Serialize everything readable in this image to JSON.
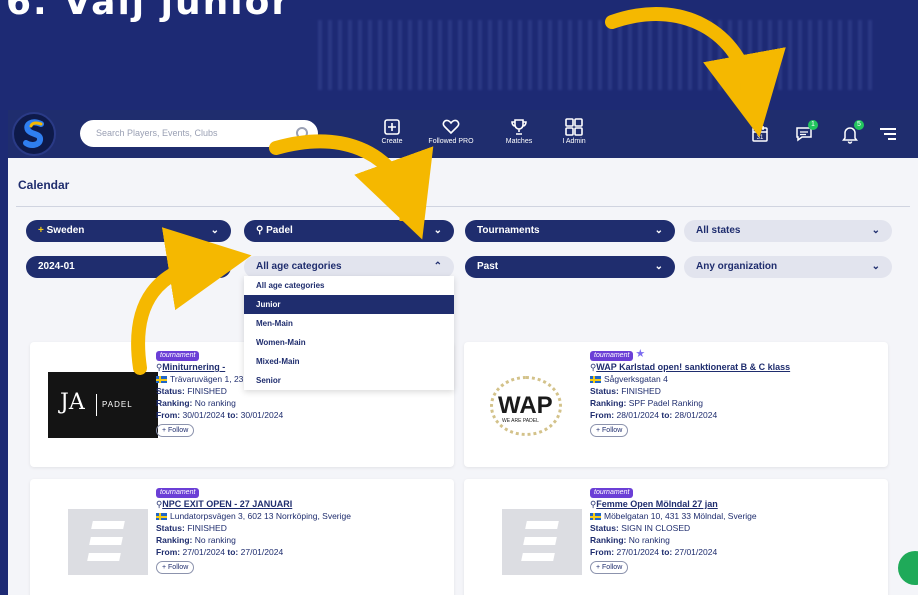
{
  "banner": {
    "title": "6.  Välj junior"
  },
  "topbar": {
    "search_placeholder": "Search Players, Events, Clubs",
    "nav": [
      {
        "label": "Create",
        "icon": "plus-square-icon"
      },
      {
        "label": "Followed PRO",
        "icon": "heart-icon"
      },
      {
        "label": "Matches",
        "icon": "trophy-icon"
      },
      {
        "label": "I Admin",
        "icon": "grid-icon"
      }
    ],
    "right_icons": [
      {
        "name": "calendar-icon",
        "text": "31"
      },
      {
        "name": "chat-icon",
        "badge": "1"
      },
      {
        "name": "bell-icon",
        "badge": "5"
      },
      {
        "name": "menu-icon"
      }
    ]
  },
  "page": {
    "title": "Calendar"
  },
  "filters": {
    "country": "Sweden",
    "sport": "Padel",
    "type": "Tournaments",
    "state": "All states",
    "month": "2024-01",
    "age": "All age categories",
    "time": "Past",
    "organization": "Any organization"
  },
  "age_dropdown": {
    "options": [
      "All age categories",
      "Junior",
      "Men-Main",
      "Women-Main",
      "Mixed-Main",
      "Senior"
    ],
    "selected": "Junior"
  },
  "cards": [
    {
      "tag": "tournament",
      "title": "Miniturnering -",
      "address": "Trävaruvägen 1, 231 66 Trelleborg, Sverige",
      "status_label": "Status:",
      "status": "FINISHED",
      "ranking_label": "Ranking:",
      "ranking": "No ranking",
      "from_label": "From:",
      "from": "30/01/2024",
      "to_label": "to:",
      "to": "30/01/2024",
      "follow": "+ Follow",
      "logo_text": "PADEL"
    },
    {
      "tag": "tournament",
      "title": "WAP Karlstad open! sanktionerat B & C klass",
      "address": "Sågverksgatan 4",
      "status_label": "Status:",
      "status": "FINISHED",
      "ranking_label": "Ranking:",
      "ranking": "SPF Padel Ranking",
      "from_label": "From:",
      "from": "28/01/2024",
      "to_label": "to:",
      "to": "28/01/2024",
      "follow": "+ Follow",
      "logo_text": "WAP",
      "logo_sub": "WE ARE PADEL"
    },
    {
      "tag": "tournament",
      "title": "NPC EXIT OPEN - 27 JANUARI",
      "address": "Lundatorpsvägen 3, 602 13 Norrköping, Sverige",
      "status_label": "Status:",
      "status": "FINISHED",
      "ranking_label": "Ranking:",
      "ranking": "No ranking",
      "from_label": "From:",
      "from": "27/01/2024",
      "to_label": "to:",
      "to": "27/01/2024",
      "follow": "+ Follow"
    },
    {
      "tag": "tournament",
      "title": "Femme Open Mölndal 27 jan",
      "address": "Möbelgatan 10, 431 33 Mölndal, Sverige",
      "status_label": "Status:",
      "status": "SIGN IN CLOSED",
      "ranking_label": "Ranking:",
      "ranking": "No ranking",
      "from_label": "From:",
      "from": "27/01/2024",
      "to_label": "to:",
      "to": "27/01/2024",
      "follow": "+ Follow"
    }
  ],
  "annotations": [
    "1",
    "2",
    "3"
  ],
  "colors": {
    "brand_navy": "#1f2d6e",
    "accent_yellow": "#f5b800",
    "tag_purple": "#6b3fd6",
    "badge_green": "#22c55e"
  }
}
